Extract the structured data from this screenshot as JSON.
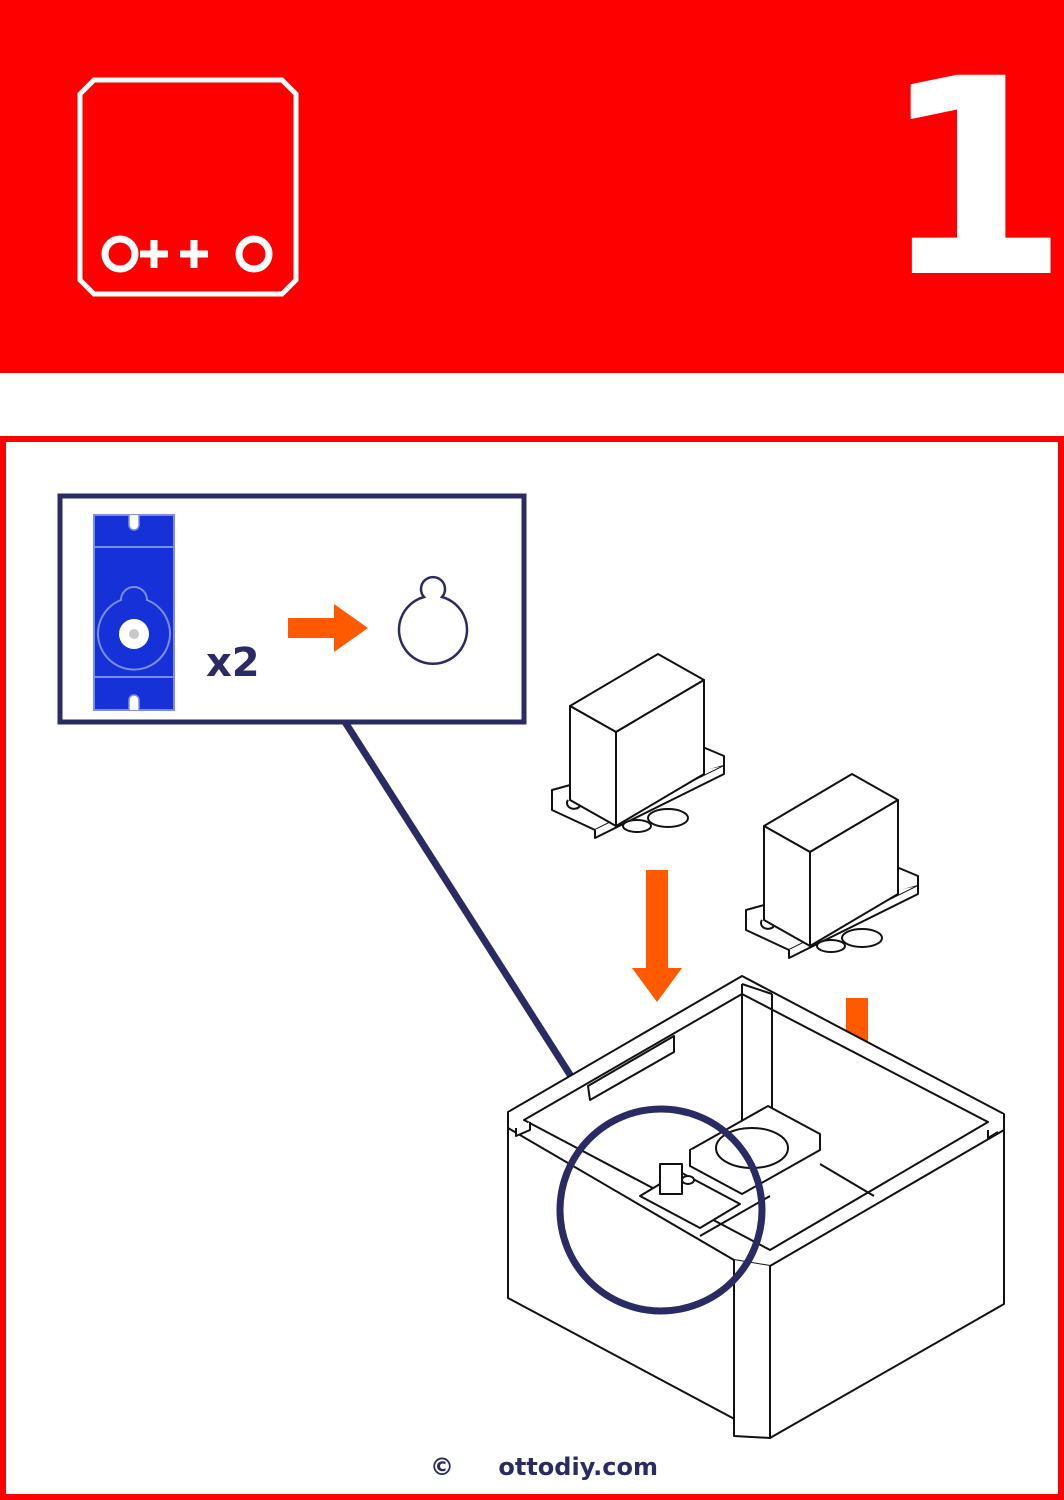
{
  "header": {
    "step_number": "1",
    "logo_text": "o++o"
  },
  "callout": {
    "quantity": "x2"
  },
  "footer": {
    "copyright": "©",
    "website": "ottodiy.com"
  },
  "colors": {
    "brand_red": "#ff0000",
    "navy": "#2b2b63",
    "servo_blue": "#1631d8",
    "arrow_orange": "#ff5a00"
  }
}
